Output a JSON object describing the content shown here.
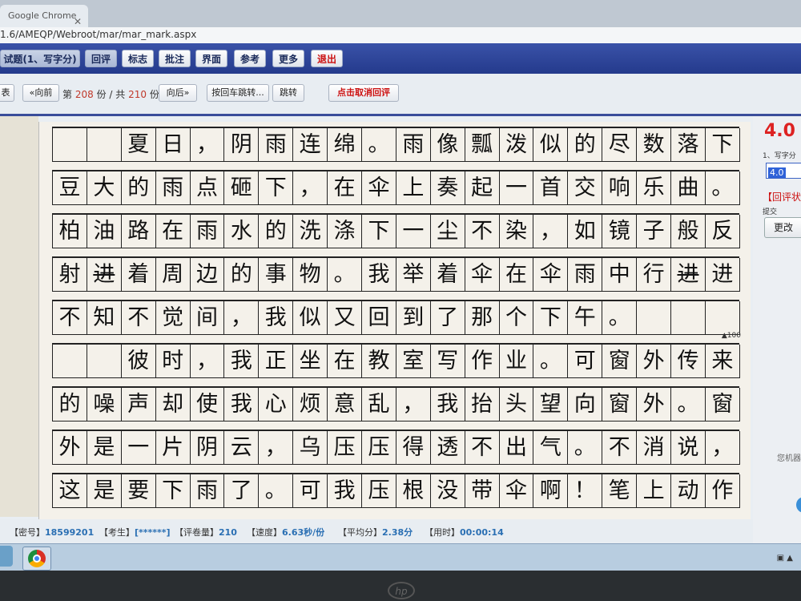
{
  "browser": {
    "tab_title": "Google Chrome",
    "url": "1.6/AMEQP/Webroot/mar/mar_mark.aspx"
  },
  "toolbar": {
    "question_label": "试题(1、写字分)",
    "buttons": [
      "回评",
      "标志",
      "批注",
      "界面",
      "参考",
      "更多",
      "退出"
    ]
  },
  "navbar": {
    "table_label": "表",
    "prev_label": "«向前",
    "page_prefix": "第",
    "current": "208",
    "page_mid": "份 / 共",
    "total": "210",
    "page_suffix": "份",
    "next_label": "向后»",
    "enter_jump_label": "按回车跳转...",
    "jump_label": "跳转",
    "cancel_review_label": "点击取消回评"
  },
  "essay": {
    "rows": [
      [
        " ",
        " ",
        "夏",
        "日",
        "，",
        "阴",
        "雨",
        "连",
        "绵",
        "。",
        "雨",
        "像",
        "瓢",
        "泼",
        "似",
        "的",
        "尽",
        "数",
        "落",
        "下",
        "，"
      ],
      [
        "豆",
        "大",
        "的",
        "雨",
        "点",
        "砸",
        "下",
        "，",
        "在",
        "伞",
        "上",
        "奏",
        "起",
        "一",
        "首",
        "交",
        "响",
        "乐",
        "曲",
        "。",
        ""
      ],
      [
        "柏",
        "油",
        "路",
        "在",
        "雨",
        "水",
        "的",
        "洗",
        "涤",
        "下",
        "一",
        "尘",
        "不",
        "染",
        "，",
        "如",
        "镜",
        "子",
        "般",
        "反",
        ""
      ],
      [
        "射",
        "进",
        "着",
        "周",
        "边",
        "的",
        "事",
        "物",
        "。",
        "我",
        "举",
        "着",
        "伞",
        "在",
        "伞",
        "雨",
        "中",
        "行",
        "进",
        "进",
        "，"
      ],
      [
        "不",
        "知",
        "不",
        "觉",
        "间",
        "，",
        "我",
        "似",
        "又",
        "回",
        "到",
        "了",
        "那",
        "个",
        "下",
        "午",
        "。",
        " ",
        " ",
        " ",
        ""
      ],
      [
        " ",
        " ",
        "彼",
        "时",
        "，",
        "我",
        "正",
        "坐",
        "在",
        "教",
        "室",
        "写",
        "作",
        "业",
        "。",
        "可",
        "窗",
        "外",
        "传",
        "来",
        ""
      ],
      [
        "的",
        "噪",
        "声",
        "却",
        "使",
        "我",
        "心",
        "烦",
        "意",
        "乱",
        "，",
        "我",
        "抬",
        "头",
        "望",
        "向",
        "窗",
        "外",
        "。",
        "窗",
        ""
      ],
      [
        "外",
        "是",
        "一",
        "片",
        "阴",
        "云",
        "，",
        "乌",
        "压",
        "压",
        "得",
        "透",
        "不",
        "出",
        "气",
        "。",
        "不",
        "消",
        "说",
        "，",
        ""
      ],
      [
        "这",
        "是",
        "要",
        "下",
        "雨",
        "了",
        "。",
        "可",
        "我",
        "压",
        "根",
        "没",
        "带",
        "伞",
        "啊",
        "！",
        "笔",
        "上",
        "动",
        "作",
        ""
      ]
    ],
    "marker": "▲100"
  },
  "status": {
    "seal_label": "【密号】",
    "seal_value": "18599201",
    "student_label": "【考生】",
    "student_value": "[******]",
    "count_label": "【评卷量】",
    "count_value": "210",
    "speed_label": "【速度】",
    "speed_value": "6.63秒/份",
    "avg_label": "【平均分】",
    "avg_value": "2.38分",
    "time_label": "【用时】",
    "time_value": "00:00:14"
  },
  "right_panel": {
    "score": "4.0",
    "item_label": "1、写字分",
    "input_value": "4.0",
    "review_status": "【回评状",
    "submit_label": "提交",
    "change_button": "更改",
    "footer_text": "您机器"
  },
  "colors": {
    "toolbar_bg": "#243a8c",
    "score_red": "#dd2222",
    "status_value_blue": "#2a6fb3"
  }
}
